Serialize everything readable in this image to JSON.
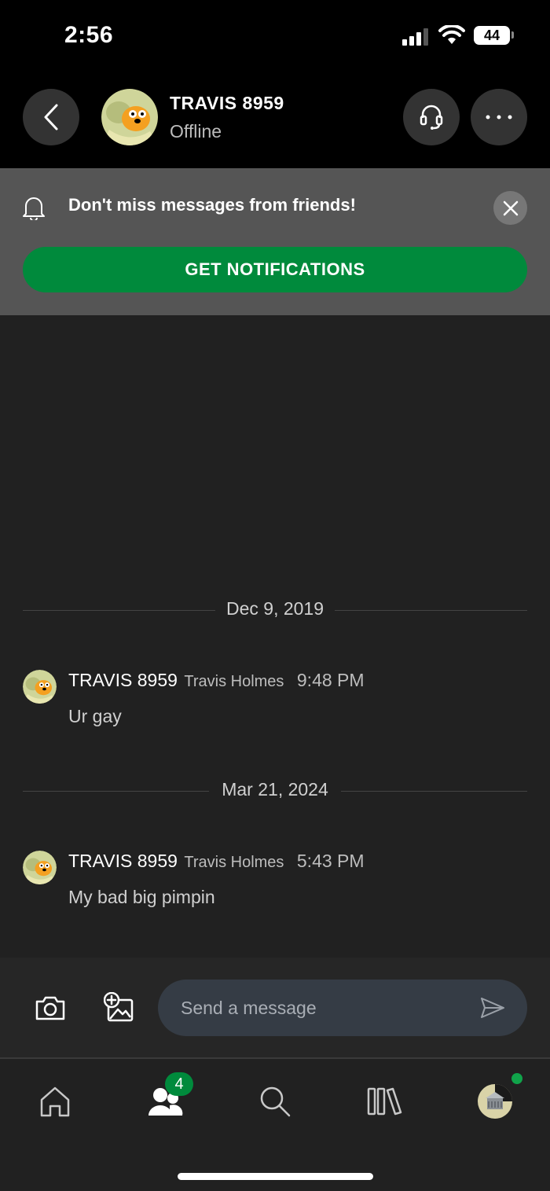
{
  "status_bar": {
    "time": "2:56",
    "battery": "44"
  },
  "header": {
    "gamertag": "TRAVIS 8959",
    "presence": "Offline",
    "icons": [
      "back-chevron-icon",
      "headset-icon",
      "more-icon"
    ]
  },
  "notification_banner": {
    "text": "Don't miss messages from friends!",
    "button_label": "GET NOTIFICATIONS"
  },
  "conversation": [
    {
      "date": "Dec 9, 2019",
      "gamertag": "TRAVIS 8959",
      "real_name": "Travis Holmes",
      "time": "9:48 PM",
      "text": "Ur gay"
    },
    {
      "date": "Mar 21, 2024",
      "gamertag": "TRAVIS 8959",
      "real_name": "Travis Holmes",
      "time": "5:43 PM",
      "text": "My bad big pimpin"
    }
  ],
  "composer": {
    "placeholder": "Send a message"
  },
  "tabbar": {
    "items": [
      "home-icon",
      "friends-icon",
      "search-icon",
      "library-icon",
      "profile-avatar"
    ],
    "friends_badge": "4"
  },
  "colors": {
    "accent_green": "#008a3c",
    "banner_bg": "#555555",
    "background": "#212121"
  }
}
